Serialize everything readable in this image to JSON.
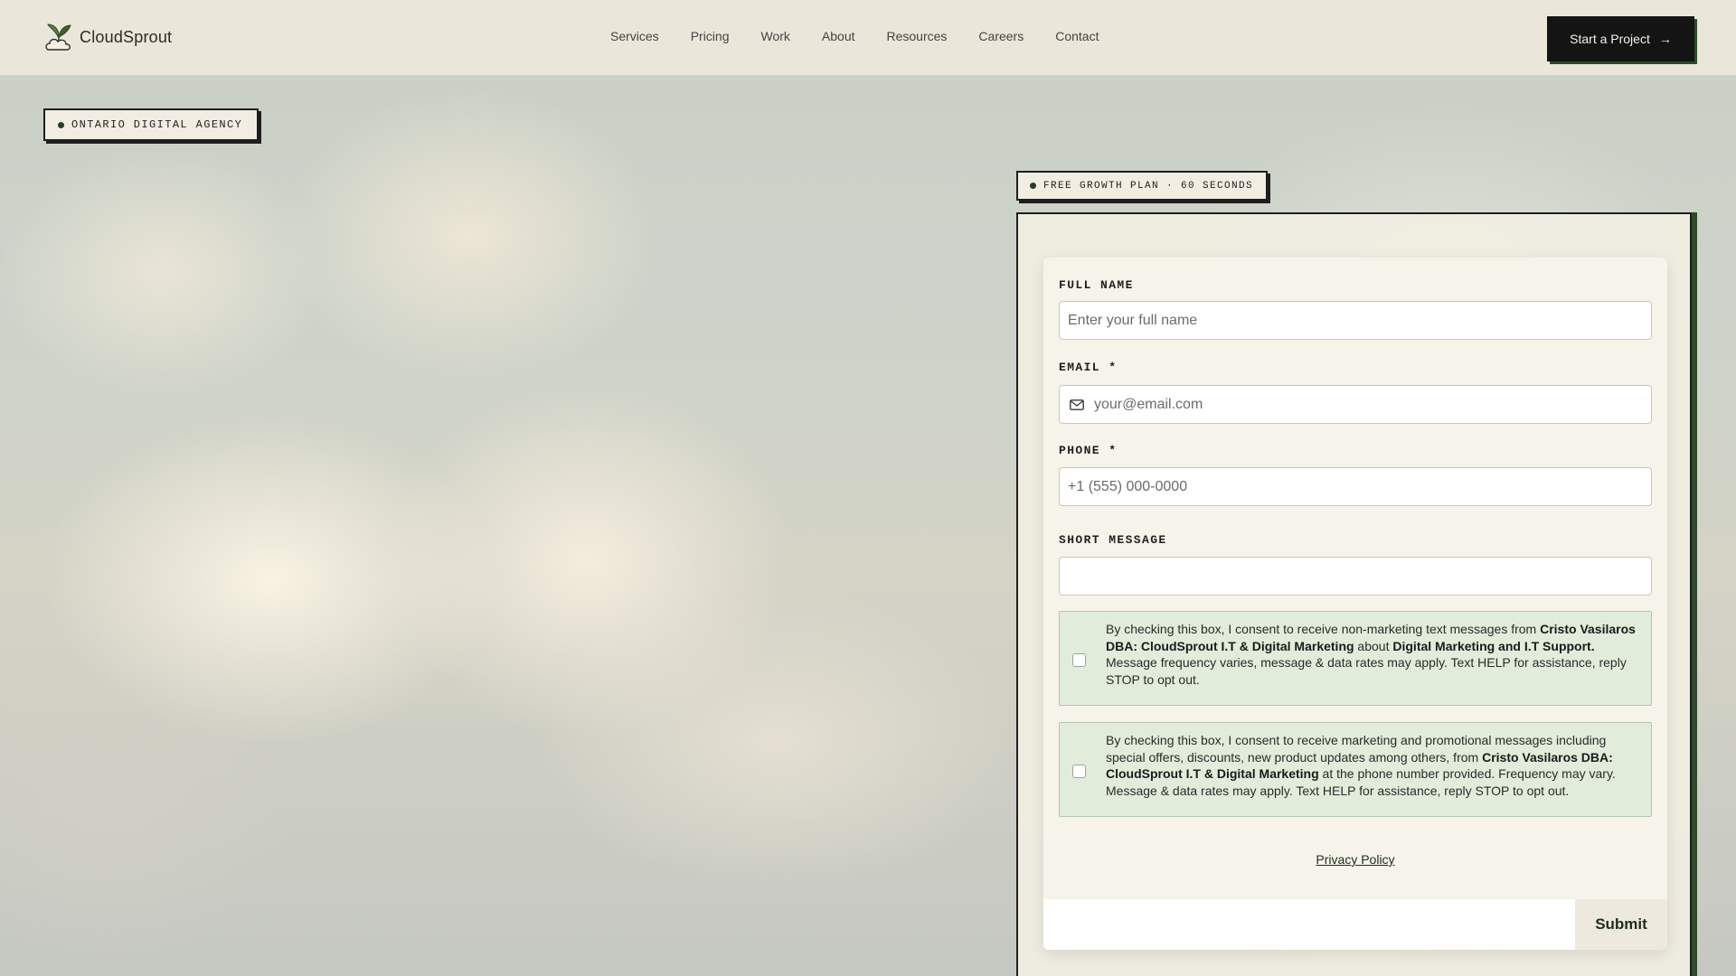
{
  "brand": {
    "name": "CloudSprout"
  },
  "nav": {
    "links": [
      "Services",
      "Pricing",
      "Work",
      "About",
      "Resources",
      "Careers",
      "Contact"
    ],
    "cta_label": "Start a Project",
    "cta_arrow": "→"
  },
  "hero": {
    "badge": "ONTARIO DIGITAL AGENCY"
  },
  "form": {
    "badge": "FREE GROWTH PLAN · 60 SECONDS",
    "full_name": {
      "label": "FULL NAME",
      "placeholder": "Enter your full name"
    },
    "email": {
      "label": "EMAIL *",
      "placeholder": "your@email.com"
    },
    "phone": {
      "label": "PHONE *",
      "placeholder": "+1 (555) 000-0000"
    },
    "message": {
      "label": "SHORT MESSAGE",
      "placeholder": ""
    },
    "consent1": {
      "t1": "By checking this box, I consent to receive non-marketing text messages from ",
      "b1": "Cristo Vasilaros DBA: CloudSprout I.T & Digital Marketing",
      "t2": " about ",
      "b2": "Digital Marketing and I.T Support.",
      "t3": " Message frequency varies, message & data rates may apply. Text HELP for assistance, reply STOP to opt out."
    },
    "consent2": {
      "t1": "By checking this box, I consent to receive marketing and promotional messages including special offers, discounts, new product updates among others, from ",
      "b1": "Cristo Vasilaros DBA: CloudSprout I.T & Digital Marketing",
      "t2": " at the phone number provided. Frequency may vary. Message & data rates may apply. Text HELP for assistance, reply STOP to opt out."
    },
    "privacy": "Privacy Policy",
    "submit": "Submit"
  },
  "colors": {
    "accent": "#2e4a2a",
    "nav_bg": "#ebe6da",
    "consent_bg": "#e2ecdb",
    "cta_bg": "#141414"
  },
  "icons": [
    "sprout-logo-icon",
    "mail-icon",
    "arrow-right-icon"
  ]
}
